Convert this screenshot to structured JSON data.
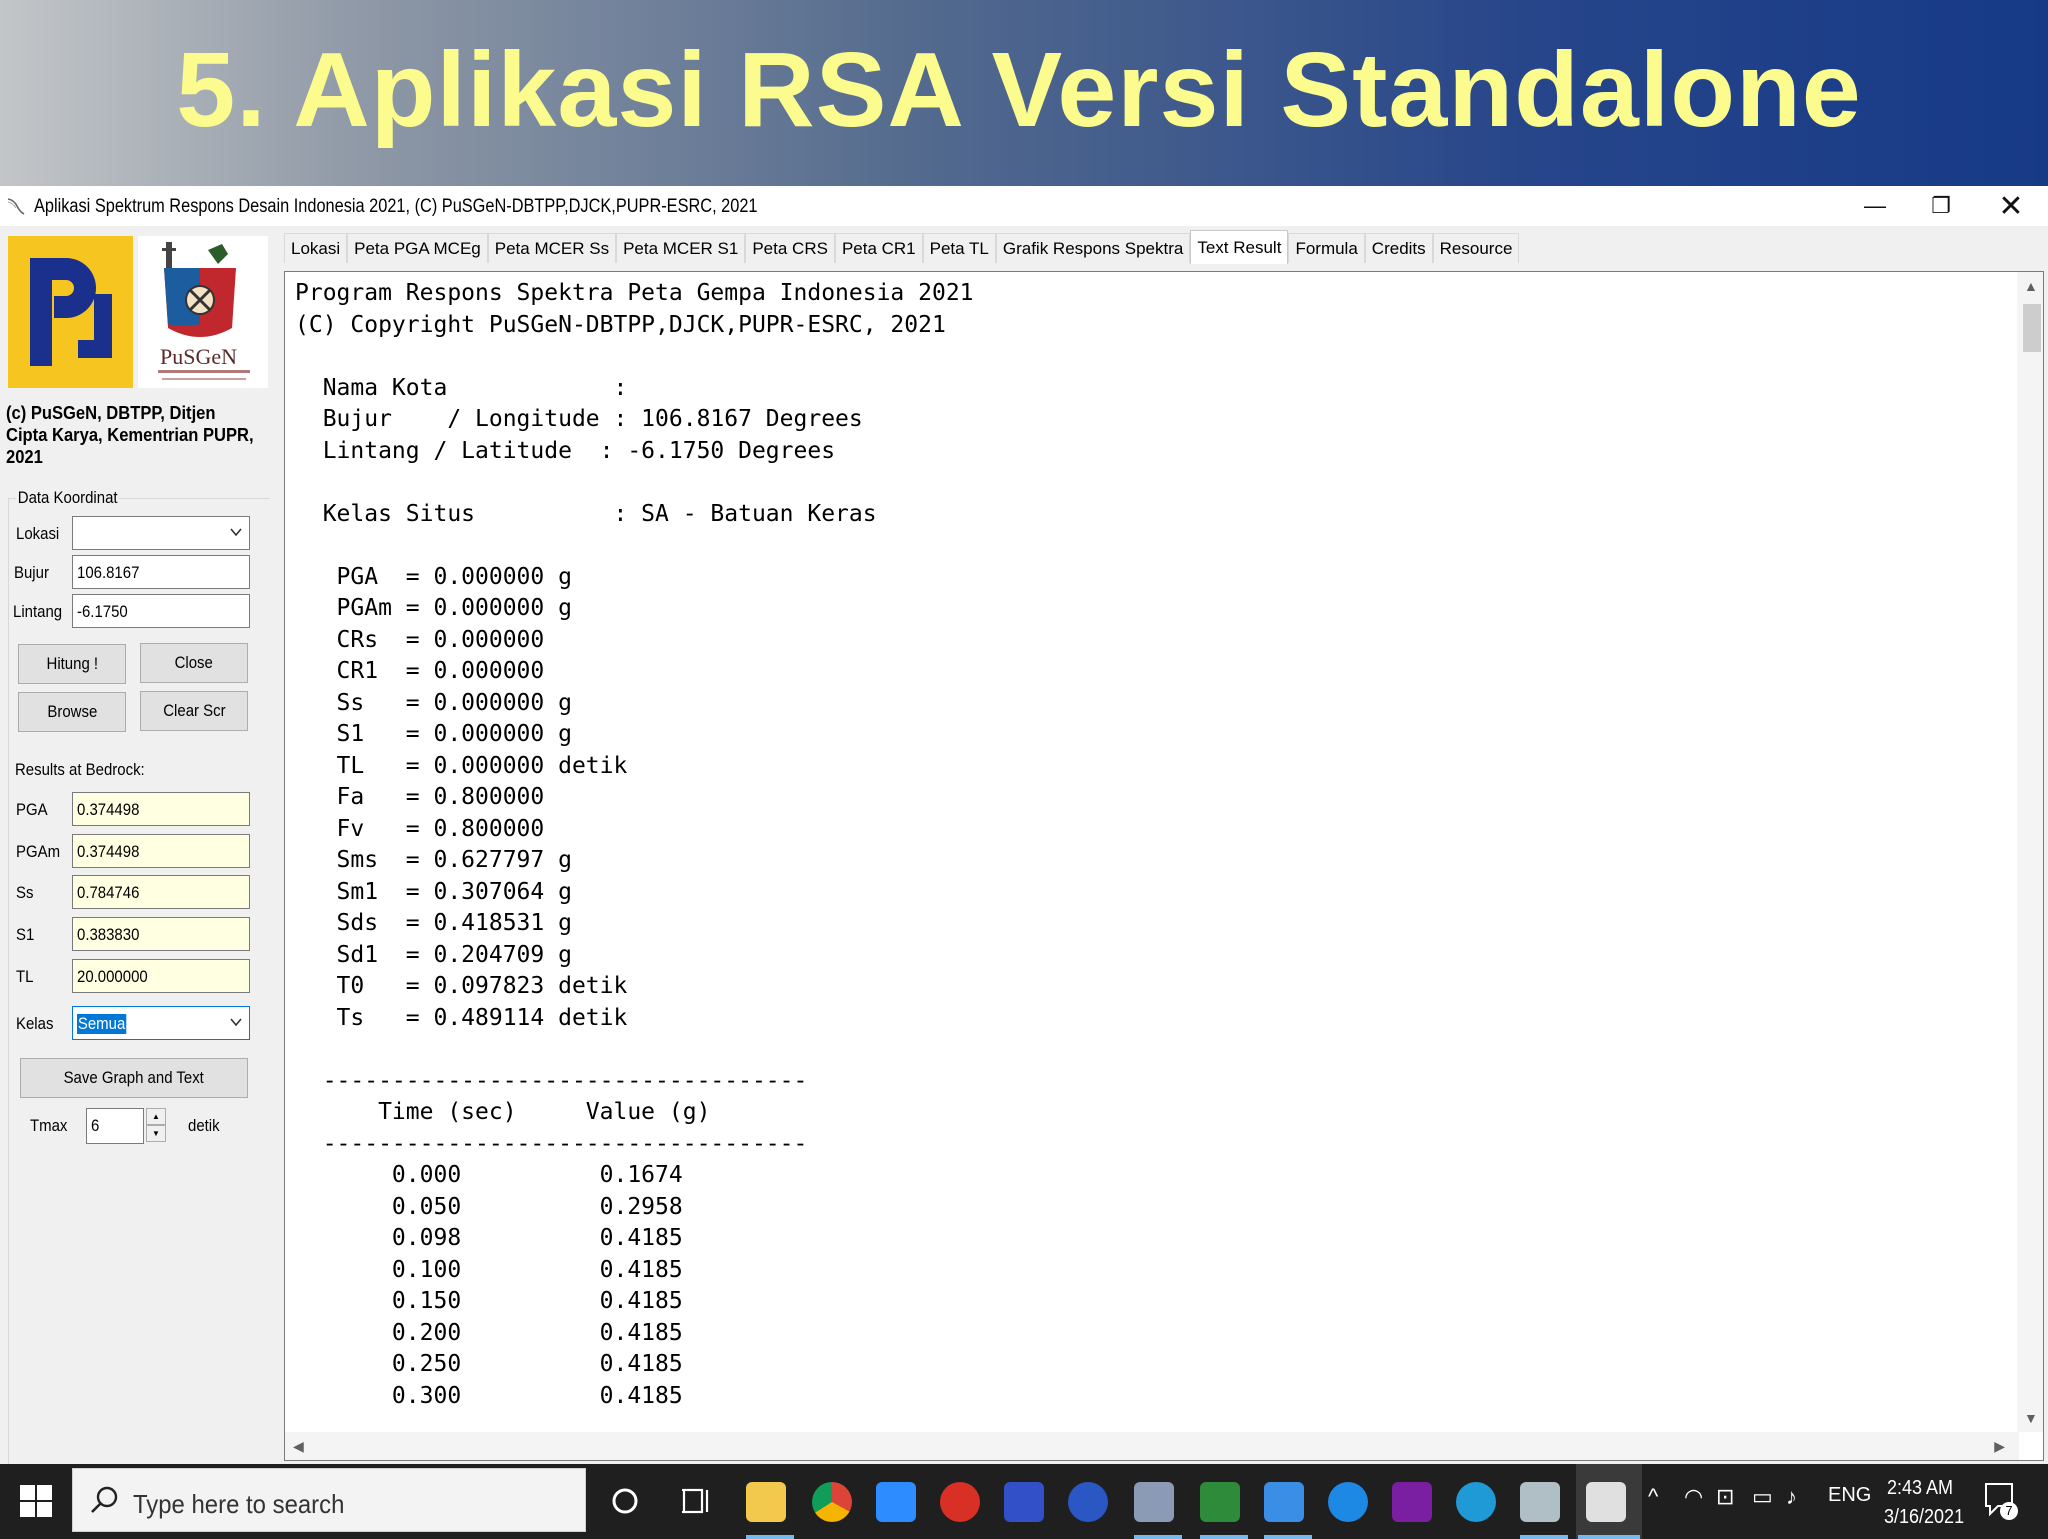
{
  "slide": {
    "title": "5. Aplikasi RSA Versi Standalone"
  },
  "window": {
    "title": "Aplikasi Spektrum Respons Desain Indonesia 2021, (C) PuSGeN-DBTPP,DJCK,PUPR-ESRC, 2021",
    "min_glyph": "—",
    "max_glyph": "❐",
    "close_glyph": "✕"
  },
  "left_panel": {
    "logo_text": "PuSGeN",
    "copyright_line1": "(c) PuSGeN, DBTPP, Ditjen",
    "copyright_line2": "Cipta Karya, Kementrian PUPR,",
    "copyright_line3": "2021",
    "data_koordinat_label": "Data Koordinat",
    "lokasi_label": "Lokasi",
    "lokasi_value": "",
    "bujur_label": "Bujur",
    "bujur_value": "106.8167",
    "lintang_label": "Lintang",
    "lintang_value": "-6.1750",
    "hitung_button": "Hitung !",
    "close_button": "Close",
    "browse_button": "Browse",
    "clear_button": "Clear Scr",
    "results_label": "Results at Bedrock:",
    "pga_label": "PGA",
    "pga_value": "0.374498",
    "pgam_label": "PGAm",
    "pgam_value": "0.374498",
    "ss_label": "Ss",
    "ss_value": "0.784746",
    "s1_label": "S1",
    "s1_value": "0.383830",
    "tl_label": "TL",
    "tl_value": "20.000000",
    "kelas_label": "Kelas",
    "kelas_value": "Semua",
    "save_button": "Save Graph and Text",
    "tmax_label": "Tmax",
    "tmax_value": "6",
    "tmax_unit": "detik"
  },
  "tabs": [
    {
      "label": "Lokasi"
    },
    {
      "label": "Peta PGA MCEg"
    },
    {
      "label": "Peta MCER Ss"
    },
    {
      "label": "Peta MCER S1"
    },
    {
      "label": "Peta CRS"
    },
    {
      "label": "Peta CR1"
    },
    {
      "label": "Peta TL"
    },
    {
      "label": "Grafik Respons Spektra"
    },
    {
      "label": "Text Result"
    },
    {
      "label": "Formula"
    },
    {
      "label": "Credits"
    },
    {
      "label": "Resource"
    }
  ],
  "text_result": "Program Respons Spektra Peta Gempa Indonesia 2021\n(C) Copyright PuSGeN-DBTPP,DJCK,PUPR-ESRC, 2021\n\n  Nama Kota            :\n  Bujur    / Longitude : 106.8167 Degrees\n  Lintang / Latitude  : -6.1750 Degrees\n\n  Kelas Situs          : SA - Batuan Keras\n\n   PGA  = 0.000000 g\n   PGAm = 0.000000 g\n   CRs  = 0.000000\n   CR1  = 0.000000\n   Ss   = 0.000000 g\n   S1   = 0.000000 g\n   TL   = 0.000000 detik\n   Fa   = 0.800000\n   Fv   = 0.800000\n   Sms  = 0.627797 g\n   Sm1  = 0.307064 g\n   Sds  = 0.418531 g\n   Sd1  = 0.204709 g\n   T0   = 0.097823 detik\n   Ts   = 0.489114 detik\n\n  -----------------------------------\n      Time (sec)     Value (g)\n  -----------------------------------\n       0.000          0.1674\n       0.050          0.2958\n       0.098          0.4185\n       0.100          0.4185\n       0.150          0.4185\n       0.200          0.4185\n       0.250          0.4185\n       0.300          0.4185",
  "taskbar": {
    "search_placeholder": "Type here to search",
    "lang": "ENG",
    "time": "2:43 AM",
    "date": "3/16/2021",
    "notif_count": "7"
  }
}
